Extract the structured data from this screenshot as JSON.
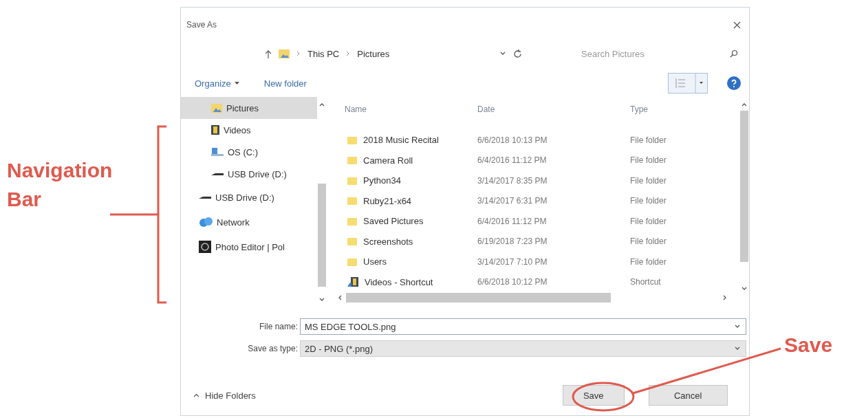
{
  "window": {
    "title": "Save As"
  },
  "address": {
    "path": [
      "This PC",
      "Pictures"
    ],
    "search_placeholder": "Search Pictures"
  },
  "toolbar": {
    "organize": "Organize",
    "new_folder": "New folder"
  },
  "navigation": [
    {
      "label": "Pictures",
      "kind": "pictures",
      "selected": true,
      "nested": true
    },
    {
      "label": "Videos",
      "kind": "videos",
      "selected": false,
      "nested": true
    },
    {
      "label": "OS (C:)",
      "kind": "drive",
      "selected": false,
      "nested": true
    },
    {
      "label": "USB Drive (D:)",
      "kind": "usb",
      "selected": false,
      "nested": true
    },
    {
      "label": "USB Drive (D:)",
      "kind": "usb",
      "selected": false,
      "nested": false
    },
    {
      "label": "Network",
      "kind": "network",
      "selected": false,
      "nested": false
    },
    {
      "label": "Photo Editor | Pol",
      "kind": "app",
      "selected": false,
      "nested": false
    }
  ],
  "file_list": {
    "columns": [
      "Name",
      "Date",
      "Type"
    ],
    "rows": [
      {
        "name": "2018 Music Recital",
        "date": "6/6/2018 10:13 PM",
        "type": "File folder",
        "kind": "folder"
      },
      {
        "name": "Camera Roll",
        "date": "6/4/2016 11:12 PM",
        "type": "File folder",
        "kind": "folder"
      },
      {
        "name": "Python34",
        "date": "3/14/2017 8:35 PM",
        "type": "File folder",
        "kind": "folder"
      },
      {
        "name": "Ruby21-x64",
        "date": "3/14/2017 6:31 PM",
        "type": "File folder",
        "kind": "folder"
      },
      {
        "name": "Saved Pictures",
        "date": "6/4/2016 11:12 PM",
        "type": "File folder",
        "kind": "folder"
      },
      {
        "name": "Screenshots",
        "date": "6/19/2018 7:23 PM",
        "type": "File folder",
        "kind": "folder"
      },
      {
        "name": "Users",
        "date": "3/14/2017 7:10 PM",
        "type": "File folder",
        "kind": "folder"
      },
      {
        "name": "Videos - Shortcut",
        "date": "6/6/2018 10:12 PM",
        "type": "Shortcut",
        "kind": "shortcut"
      }
    ]
  },
  "file_name": {
    "label": "File name:",
    "value": "MS EDGE TOOLS.png"
  },
  "save_type": {
    "label": "Save as type:",
    "value": "2D - PNG (*.png)"
  },
  "footer": {
    "hide_folders": "Hide Folders",
    "buttons": [
      "Save",
      "Cancel"
    ]
  },
  "annotations": {
    "navigation": "Navigation Bar",
    "save": "Save"
  }
}
